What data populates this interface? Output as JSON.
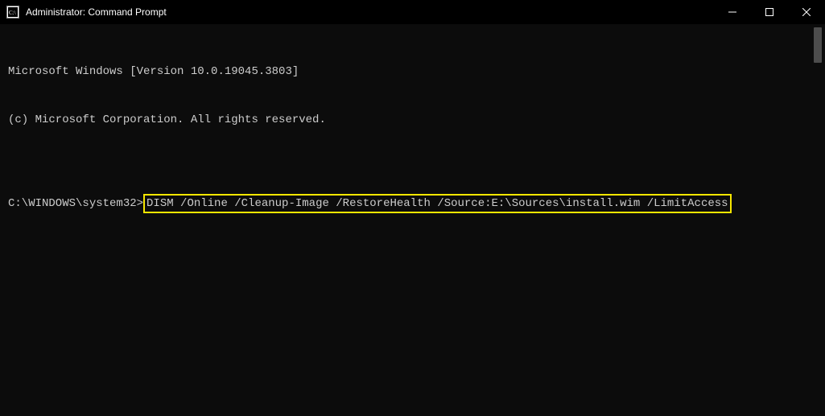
{
  "titlebar": {
    "title": "Administrator: Command Prompt"
  },
  "terminal": {
    "line1": "Microsoft Windows [Version 10.0.19045.3803]",
    "line2": "(c) Microsoft Corporation. All rights reserved.",
    "blank1": "",
    "prompt": "C:\\WINDOWS\\system32>",
    "command": "DISM /Online /Cleanup-Image /RestoreHealth /Source:E:\\Sources\\install.wim /LimitAccess"
  }
}
